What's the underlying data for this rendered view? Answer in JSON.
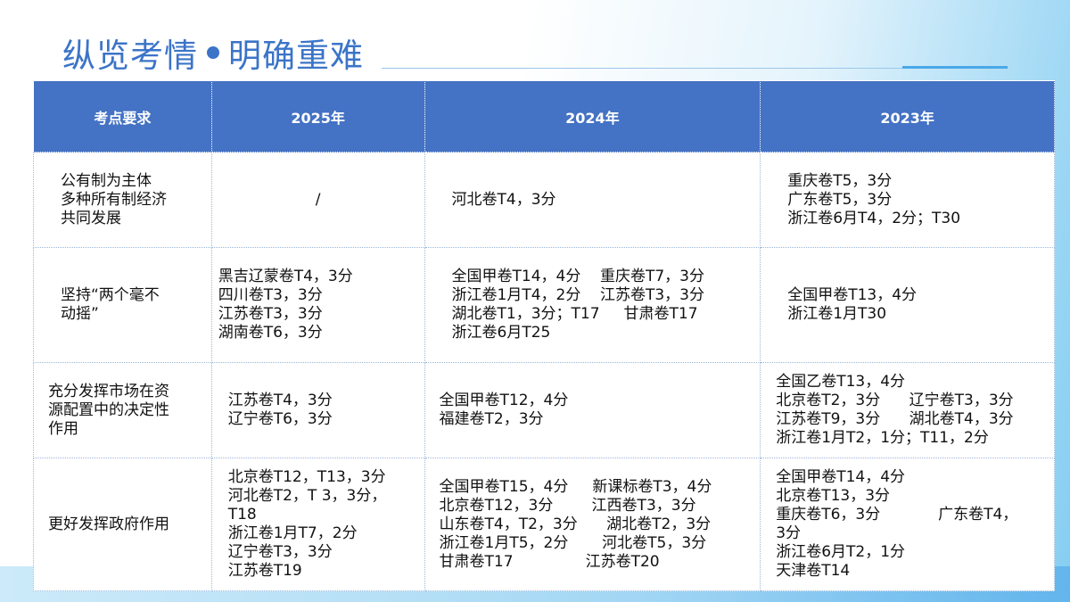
{
  "title": {
    "left": "纵览考情",
    "right": "明确重难"
  },
  "table": {
    "headers": [
      "考点要求",
      "2025年",
      "2024年",
      "2023年"
    ],
    "rows": [
      {
        "req": [
          "公有制为主体",
          "多种所有制经济",
          "共同发展"
        ],
        "y2025": [
          "/"
        ],
        "y2024": [
          "河北卷T4，3分"
        ],
        "y2023": [
          "重庆卷T5，3分",
          "广东卷T5，3分",
          "浙江卷6月T4，2分；T30"
        ]
      },
      {
        "req": [
          "坚持“两个毫不",
          "动摇”"
        ],
        "y2025": [
          "黑吉辽蒙卷T4，3分",
          "四川卷T3，3分",
          "江苏卷T3，3分",
          "湖南卷T6，3分"
        ],
        "y2024": [
          "全国甲卷T14，4分    重庆卷T7，3分",
          "浙江卷1月T4，2分    江苏卷T3，3分",
          "湖北卷T1，3分；T17     甘肃卷T17",
          "浙江卷6月T25"
        ],
        "y2023": [
          "全国甲卷T13，4分",
          "浙江卷1月T30"
        ]
      },
      {
        "req": [
          "充分发挥市场在资",
          "源配置中的决定性",
          "作用"
        ],
        "y2025": [
          "江苏卷T4，3分",
          "辽宁卷T6，3分"
        ],
        "y2024": [
          "全国甲卷T12，4分",
          "福建卷T2，3分"
        ],
        "y2023": [
          "全国乙卷T13，4分",
          "北京卷T2，3分      辽宁卷T3，3分",
          "江苏卷T9，3分      湖北卷T4，3分",
          "浙江卷1月T2，1分；T11，2分"
        ]
      },
      {
        "req": [
          "更好发挥政府作用"
        ],
        "y2025": [
          "北京卷T12，T13，3分",
          "河北卷T2，T 3，3分，",
          "T18",
          "浙江卷1月T7，2分",
          "辽宁卷T3，3分",
          "江苏卷T19"
        ],
        "y2024": [
          "全国甲卷T15，4分     新课标卷T3，4分",
          "北京卷T12，3分        江西卷T3，3分",
          "山东卷T4，T2，3分      湖北卷T2，3分",
          "浙江卷1月T5，2分       河北卷T5，3分",
          "甘肃卷T17               江苏卷T20"
        ],
        "y2023": [
          "全国甲卷T14，4分",
          "北京卷T13，3分",
          "重庆卷T6，3分            广东卷T4，",
          "3分",
          "浙江卷6月T2，1分",
          "天津卷T14"
        ]
      }
    ]
  }
}
